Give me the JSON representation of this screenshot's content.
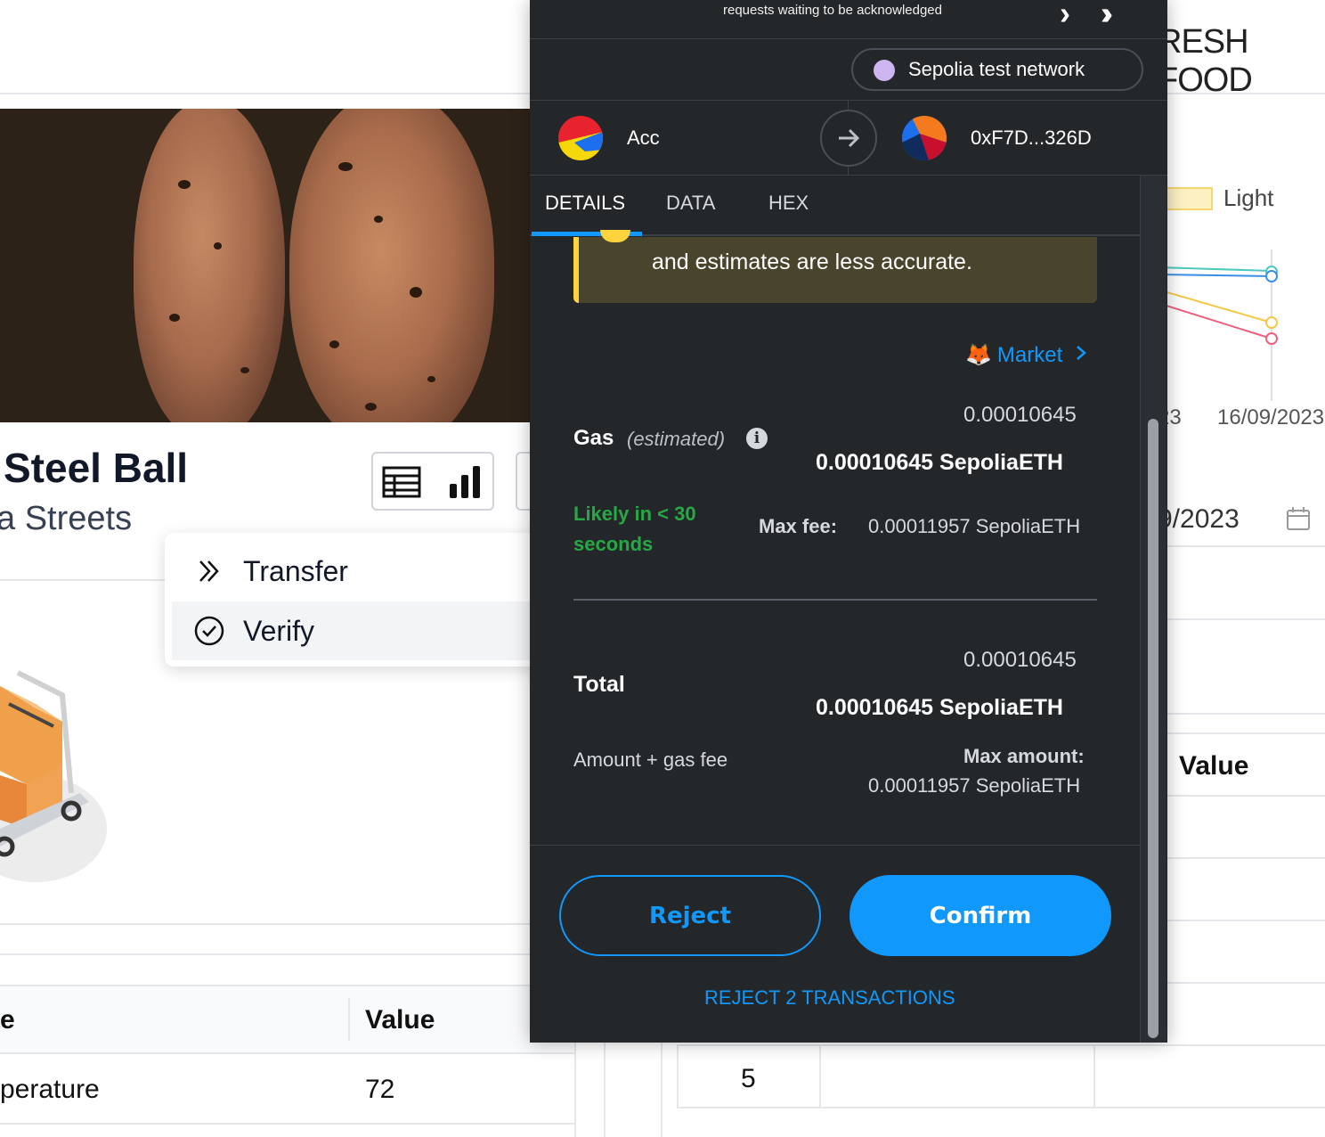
{
  "background": {
    "brand": "RESH FOOD",
    "product": {
      "title": "Steel Ball",
      "subtitle": "a Streets"
    },
    "context_menu": {
      "items": [
        {
          "label": "Transfer",
          "icon": "double-chevron-right-icon"
        },
        {
          "label": "Verify",
          "icon": "check-circle-icon"
        }
      ]
    },
    "left_table": {
      "headers": [
        "e",
        "Value"
      ],
      "rows": [
        [
          "perature",
          "72"
        ]
      ]
    },
    "right_panel": {
      "legend_label": "Light",
      "date_ticks": [
        "23",
        "16/09/2023"
      ],
      "date_value": "9/2023",
      "column_header": "Value",
      "cell_value": "5"
    }
  },
  "wallet": {
    "queue_text": "requests waiting to be acknowledged",
    "network": "Sepolia test network",
    "from_account": "Acc",
    "to_address": "0xF7D...326D",
    "tabs": [
      "DETAILS",
      "DATA",
      "HEX"
    ],
    "active_tab": "DETAILS",
    "warning_text": "and estimates are less accurate.",
    "market_label": "Market",
    "gas": {
      "label": "Gas",
      "estimated": "(estimated)",
      "fiat_value": "0.00010645",
      "eth_value": "0.00010645 SepoliaETH",
      "likely": "Likely in < 30 seconds",
      "max_fee_label": "Max fee:",
      "max_fee_value": "0.00011957 SepoliaETH"
    },
    "total": {
      "label": "Total",
      "fiat_value": "0.00010645",
      "eth_value": "0.00010645 SepoliaETH",
      "amount_gas": "Amount + gas fee",
      "max_amount_label": "Max amount:",
      "max_amount_value": "0.00011957 SepoliaETH"
    },
    "buttons": {
      "reject": "Reject",
      "confirm": "Confirm",
      "reject_all": "REJECT 2 TRANSACTIONS"
    },
    "colors": {
      "accent": "#1098fc",
      "background": "#24272a",
      "success": "#28a745",
      "warning": "#ffd33d"
    }
  }
}
